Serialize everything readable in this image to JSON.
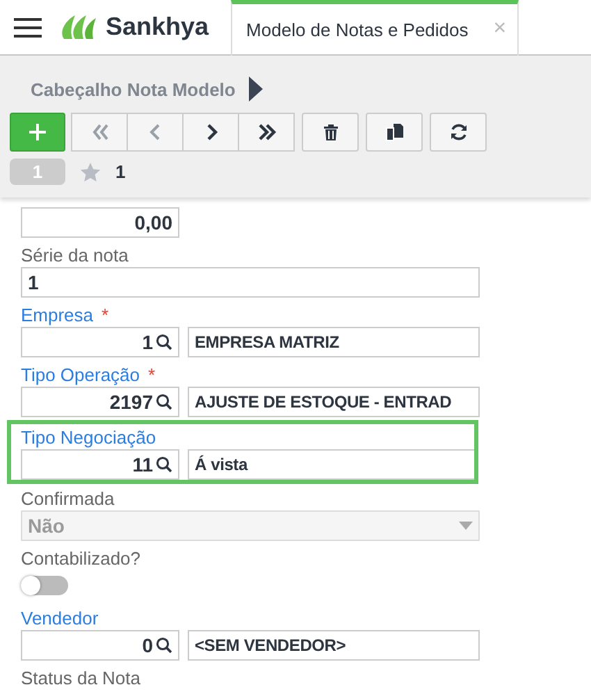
{
  "header": {
    "app_name": "Sankhya",
    "tabs": [
      {
        "label": "Modelo de Notas e Pedidos",
        "selected": true,
        "close": "×"
      }
    ]
  },
  "breadcrumb": "Cabeçalho Nota Modelo",
  "toolbar": [
    {
      "kind": "add",
      "disabled": false
    },
    {
      "kind": "first",
      "disabled": true
    },
    {
      "kind": "prev",
      "disabled": true
    },
    {
      "kind": "next",
      "disabled": false
    },
    {
      "kind": "last",
      "disabled": false
    },
    {
      "kind": "delete",
      "disabled": false
    },
    {
      "kind": "copy",
      "disabled": false
    },
    {
      "kind": "refresh",
      "disabled": false
    }
  ],
  "record": {
    "number": "1",
    "favorites": "1"
  },
  "fields": [
    {
      "kind": "number",
      "value": "0,00"
    },
    {
      "kind": "text",
      "label": "Série da nota",
      "value": "1"
    },
    {
      "kind": "lookup",
      "label": "Empresa",
      "required_mark": "*",
      "code": "1",
      "description": "EMPRESA MATRIZ"
    },
    {
      "kind": "lookup",
      "label": "Tipo Operação",
      "required_mark": "*",
      "code": "2197",
      "description": "AJUSTE DE ESTOQUE - ENTRAD"
    },
    {
      "kind": "lookup",
      "label": "Tipo Negociação",
      "code": "11",
      "description": "Á vista",
      "highlighted": true
    },
    {
      "kind": "select",
      "label": "Confirmada",
      "value": "Não",
      "disabled": true
    },
    {
      "kind": "toggle",
      "label": "Contabilizado?",
      "on": false
    },
    {
      "kind": "lookup",
      "label": "Vendedor",
      "code": "0",
      "description": "<SEM VENDEDOR>"
    },
    {
      "kind": "label",
      "label": "Status da Nota"
    }
  ]
}
